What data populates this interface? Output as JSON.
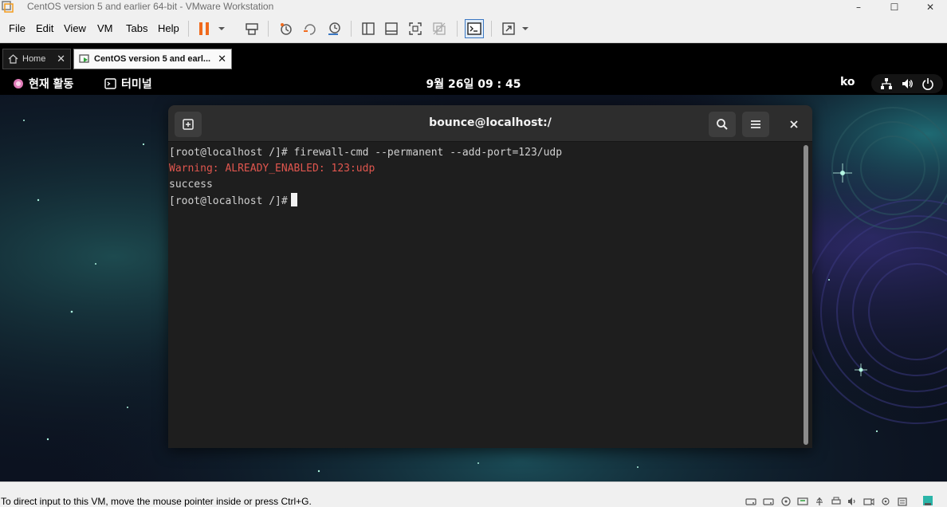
{
  "window": {
    "title": "CentOS version 5 and earlier 64-bit - VMware Workstation",
    "minimize_glyph": "–",
    "maximize_glyph": "☐",
    "close_glyph": "✕"
  },
  "menu": {
    "items": [
      "File",
      "Edit",
      "View",
      "VM",
      "Tabs",
      "Help"
    ]
  },
  "toolbar": {
    "buttons": [
      "pause-icon",
      "send-ctrl-alt-del-icon",
      "snapshot-icon",
      "revert-snapshot-icon",
      "snapshot-manager-icon",
      "library-icon",
      "thumbnail-icon",
      "full-screen-icon",
      "unity-icon",
      "console-view-icon",
      "stretch-icon"
    ],
    "accent": "#f06a1d"
  },
  "tabs": [
    {
      "label": "Home",
      "close": "✕",
      "icon": "home-icon"
    },
    {
      "label": "CentOS version 5 and earl...",
      "close": "✕",
      "icon": "vm-icon",
      "active": true
    }
  ],
  "gnome": {
    "activities": "현재 활동",
    "app_name": "터미널",
    "clock": "9월 26일 09 : 45",
    "input_lang": "ko",
    "system_icons": [
      "network-icon",
      "volume-icon",
      "power-icon"
    ]
  },
  "terminal": {
    "title": "bounce@localhost:/",
    "lines": [
      {
        "text": "[root@localhost /]# firewall-cmd --permanent --add-port=123/udp",
        "type": "normal"
      },
      {
        "text": "Warning: ALREADY_ENABLED: 123:udp",
        "type": "warn"
      },
      {
        "text": "success",
        "type": "normal"
      }
    ],
    "prompt": "[root@localhost /]#",
    "warning_color": "#e0564e"
  },
  "statusbar": {
    "hint": "To direct input to this VM, move the mouse pointer inside or press Ctrl+G.",
    "device_icons": [
      "hard-disk-icon",
      "hard-disk-icon",
      "cd-dvd-icon",
      "network-adapter-icon",
      "usb-icon",
      "printer-icon",
      "sound-icon",
      "camera-icon",
      "display-icon",
      "message-icon"
    ]
  }
}
